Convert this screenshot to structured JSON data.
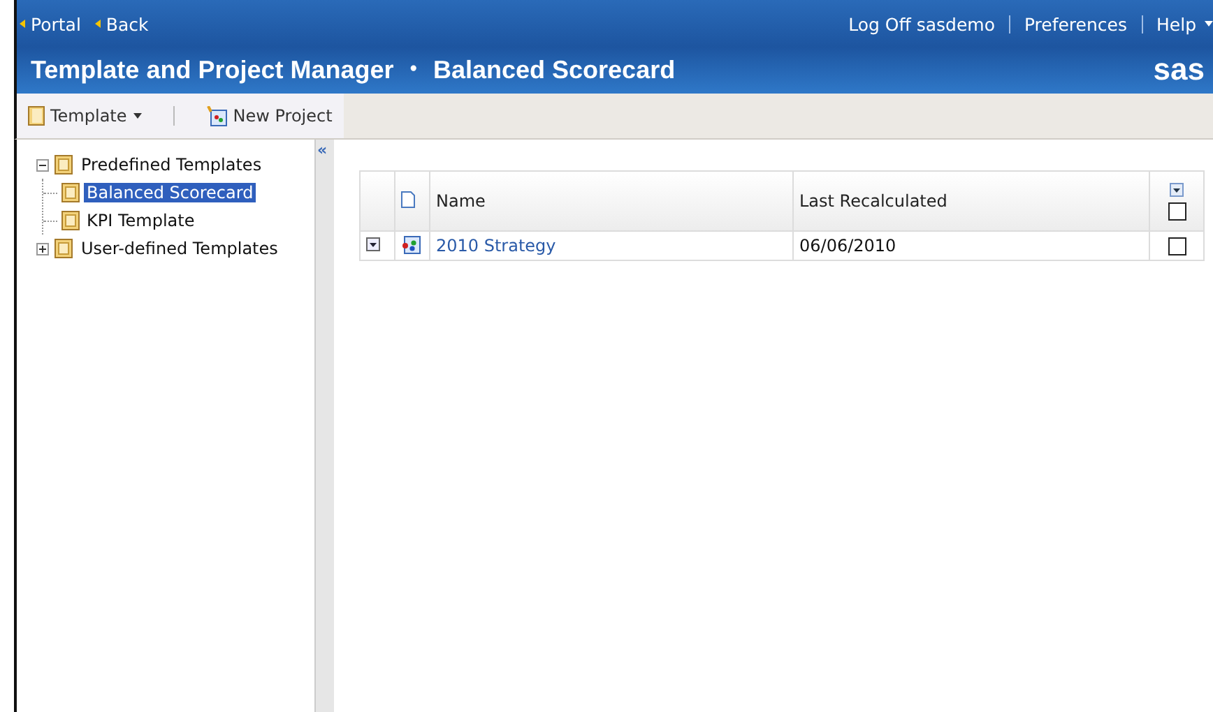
{
  "nav": {
    "links": [
      "Portal",
      "Back"
    ],
    "user_links": [
      "Log Off sasdemo",
      "Preferences",
      "Help"
    ]
  },
  "header": {
    "title": "Template and Project Manager",
    "separator": "•",
    "subtitle": "Balanced Scorecard",
    "logo": "sas"
  },
  "toolbar": {
    "buttons": [
      {
        "label": "Template",
        "kind": "menu"
      },
      {
        "label": "New Project",
        "kind": "action"
      }
    ]
  },
  "tree": [
    {
      "label": "Predefined Templates",
      "expanded": true,
      "selected": false,
      "children": [
        {
          "label": "Balanced Scorecard",
          "selected": true
        },
        {
          "label": "KPI Template",
          "selected": false
        }
      ]
    },
    {
      "label": "User-defined Templates",
      "expanded": false,
      "selected": false
    }
  ],
  "collapse_button": "«",
  "table": {
    "columns": [
      "Name",
      "Last Recalculated"
    ],
    "header_checkbox": {
      "checked": false
    },
    "rows": [
      {
        "name": "2010 Strategy",
        "last_recalculated": "06/06/2010",
        "checked": false
      }
    ]
  }
}
